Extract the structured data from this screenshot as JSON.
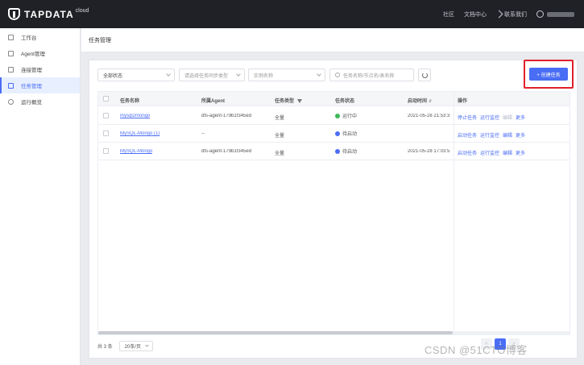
{
  "brand": {
    "name": "TAPDATA",
    "sup": "cloud"
  },
  "topnav": {
    "community": "社区",
    "docs": "文档中心",
    "contact": "联系我们"
  },
  "sidebar": {
    "items": [
      {
        "label": "工作台"
      },
      {
        "label": "Agent管理"
      },
      {
        "label": "连接管理"
      },
      {
        "label": "任务管理"
      },
      {
        "label": "运行概览"
      }
    ]
  },
  "page": {
    "title": "任务管理"
  },
  "filters": {
    "status": "全部状态",
    "sync_type": "请选择任务同步类型",
    "instance": "实例名称",
    "search_placeholder": "任务名称/节点名/表名称"
  },
  "buttons": {
    "create": "+ 创建任务"
  },
  "table": {
    "headers": {
      "name": "任务名称",
      "agent": "所属Agent",
      "type": "任务类型",
      "status": "任务状态",
      "start": "启动时间",
      "ops": "操作"
    },
    "rows": [
      {
        "name": "mysql2mongo",
        "agent": "dfs-agent-179b1f345ed",
        "type": "全量",
        "status": "运行中",
        "start": "2021-05-28 21:53:3",
        "op1": "停止任务",
        "op2": "运行监控",
        "op3": "编辑",
        "op4": "更多"
      },
      {
        "name": "MySQL-Mongo (1)",
        "agent": "--",
        "type": "全量",
        "status": "待启动",
        "start": "",
        "op1": "启动任务",
        "op2": "运行监控",
        "op3": "编辑",
        "op4": "更多"
      },
      {
        "name": "MySQL-Mongo",
        "agent": "dfs-agent-179b1f345ed",
        "type": "全量",
        "status": "待启动",
        "start": "2021-05-28 17:03:5",
        "op1": "启动任务",
        "op2": "运行监控",
        "op3": "编辑",
        "op4": "更多"
      }
    ]
  },
  "footer": {
    "total": "共 3 条",
    "page_size": "20条/页",
    "current_page": "1"
  },
  "watermark": "CSDN @51CTO博客",
  "colors": {
    "accent": "#4a6df5",
    "running": "#3db95a",
    "pending": "#4a6df5",
    "highlight": "#e0202a"
  }
}
